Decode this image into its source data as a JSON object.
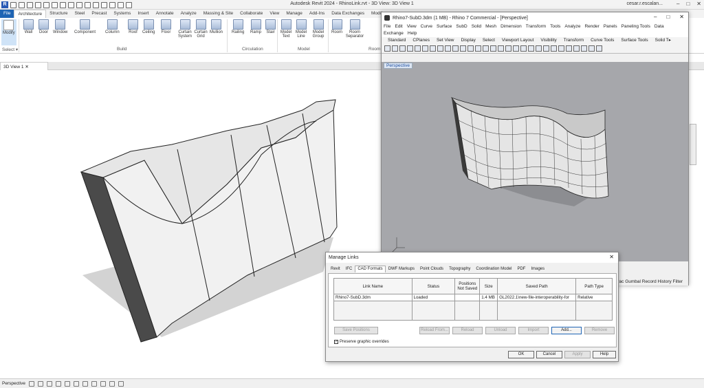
{
  "app": {
    "title": "Autodesk Revit 2024 - RhinoLink.rvt - 3D View: 3D View 1",
    "user": "cesar.r.escalan...",
    "logo": "R"
  },
  "tabs": [
    "File",
    "Architecture",
    "Structure",
    "Steel",
    "Precast",
    "Systems",
    "Insert",
    "Annotate",
    "Analyze",
    "Massing & Site",
    "Collaborate",
    "View",
    "Manage",
    "Add-Ins",
    "Data Exchanges",
    "Modif"
  ],
  "ribbon": {
    "modify": "Modify",
    "select": "Select ▾",
    "build_buttons": [
      "Wall",
      "Door",
      "Window",
      "Component",
      "Column",
      "Roof",
      "Ceiling",
      "Floor",
      "Curtain System",
      "Curtain Grid",
      "Mullion"
    ],
    "circulation_buttons": [
      "Railing",
      "Ramp",
      "Stair"
    ],
    "model_buttons": [
      "Model Text",
      "Model Line",
      "Model Group"
    ],
    "room_buttons": [
      "Room",
      "Room Separator"
    ],
    "panels": {
      "build": "Build",
      "circulation": "Circulation",
      "model": "Model",
      "room": "Room"
    }
  },
  "view_tab": "3D View 1",
  "status": {
    "view_mode": "Perspective"
  },
  "rhino": {
    "title": "Rhino7-SubD.3dm (1 MB) - Rhino 7 Commercial - [Perspective]",
    "menu": [
      "File",
      "Edit",
      "View",
      "Curve",
      "Surface",
      "SubD",
      "Solid",
      "Mesh",
      "Dimension",
      "Transform",
      "Tools",
      "Analyze",
      "Render",
      "Panels",
      "Paneling Tools",
      "Data Exchange",
      "Help"
    ],
    "toolbar_tabs": [
      "Standard",
      "CPlanes",
      "Set View",
      "Display",
      "Select",
      "Viewport Layout",
      "Visibility",
      "Transform",
      "Curve Tools",
      "Surface Tools",
      "Solid T▸"
    ],
    "viewport_label": "Perspective",
    "status_tail": "Trac  Gumbal  Record History  Filter"
  },
  "dialog": {
    "title": "Manage Links",
    "tabs": [
      "Revit",
      "IFC",
      "CAD Formats",
      "DWF Markups",
      "Point Clouds",
      "Topography",
      "Coordination Model",
      "PDF",
      "Images"
    ],
    "active_tab": "CAD Formats",
    "columns": [
      "Link Name",
      "Status",
      "Positions Not Saved",
      "Size",
      "Saved Path",
      "Path Type"
    ],
    "rows": [
      {
        "name": "Rhino7-SubD.3dm",
        "status": "Loaded",
        "positions": "",
        "size": "1.4 MB",
        "path": "GL2022.1\\new-file-interoperability-for",
        "path_type": "Relative"
      }
    ],
    "buttons": {
      "save_positions": "Save Positions",
      "reload_from": "Reload From...",
      "reload": "Reload",
      "unload": "Unload",
      "import": "Import",
      "add": "Add...",
      "remove": "Remove",
      "ok": "OK",
      "cancel": "Cancel",
      "apply": "Apply",
      "help": "Help"
    },
    "preserve_overrides": "Preserve graphic overrides",
    "preserve_checked": "✓"
  }
}
